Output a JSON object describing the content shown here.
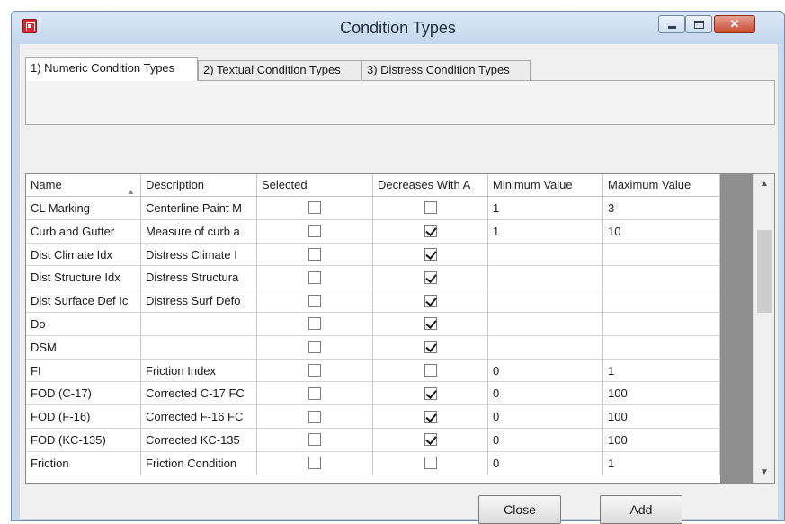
{
  "window": {
    "title": "Condition Types",
    "close_glyph": "✕"
  },
  "tabs": [
    {
      "label": "1) Numeric Condition Types",
      "active": true
    },
    {
      "label": "2) Textual Condition Types",
      "active": false
    },
    {
      "label": "3) Distress Condition Types",
      "active": false
    }
  ],
  "grid": {
    "columns": [
      "Name",
      "Description",
      "Selected",
      "Decreases With A",
      "Minimum Value",
      "Maximum Value"
    ],
    "sort_indicator": "▲",
    "rows": [
      {
        "name": "CL Marking",
        "description": "Centerline Paint M",
        "selected": false,
        "decreases": false,
        "min": "1",
        "max": "3"
      },
      {
        "name": "Curb and Gutter",
        "description": "Measure of curb a",
        "selected": false,
        "decreases": true,
        "min": "1",
        "max": "10"
      },
      {
        "name": "Dist Climate Idx",
        "description": "Distress Climate I",
        "selected": false,
        "decreases": true,
        "min": "",
        "max": ""
      },
      {
        "name": "Dist Structure Idx",
        "description": "Distress Structura",
        "selected": false,
        "decreases": true,
        "min": "",
        "max": ""
      },
      {
        "name": "Dist Surface Def Ic",
        "description": "Distress Surf Defo",
        "selected": false,
        "decreases": true,
        "min": "",
        "max": ""
      },
      {
        "name": "Do",
        "description": "",
        "selected": false,
        "decreases": true,
        "min": "",
        "max": ""
      },
      {
        "name": "DSM",
        "description": "",
        "selected": false,
        "decreases": true,
        "min": "",
        "max": ""
      },
      {
        "name": "FI",
        "description": "Friction Index",
        "selected": false,
        "decreases": false,
        "min": "0",
        "max": "1"
      },
      {
        "name": "FOD (C-17)",
        "description": "Corrected C-17 FC",
        "selected": false,
        "decreases": true,
        "min": "0",
        "max": "100"
      },
      {
        "name": "FOD (F-16)",
        "description": "Corrected F-16 FC",
        "selected": false,
        "decreases": true,
        "min": "0",
        "max": "100"
      },
      {
        "name": "FOD (KC-135)",
        "description": "Corrected KC-135",
        "selected": false,
        "decreases": true,
        "min": "0",
        "max": "100"
      },
      {
        "name": "Friction",
        "description": "Friction Condition",
        "selected": false,
        "decreases": false,
        "min": "0",
        "max": "1"
      }
    ]
  },
  "scrollbar": {
    "up_glyph": "▲",
    "down_glyph": "▼"
  },
  "buttons": {
    "close": "Close",
    "add": "Add"
  }
}
